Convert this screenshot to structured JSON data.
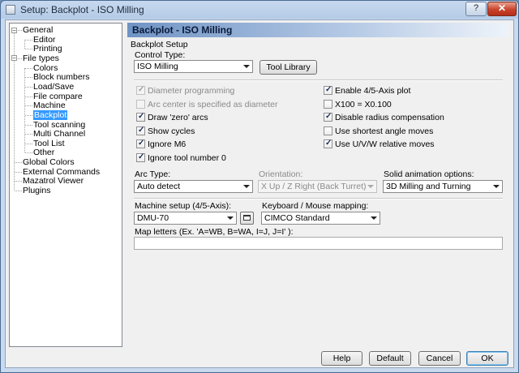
{
  "window": {
    "title": "Setup: Backplot - ISO Milling",
    "help_glyph": "?",
    "close_glyph": "✕",
    "icon": "window-icon"
  },
  "tree": {
    "items": [
      {
        "label": "General",
        "level": 0,
        "expander": "−"
      },
      {
        "label": "Editor",
        "level": 1
      },
      {
        "label": "Printing",
        "level": 1
      },
      {
        "label": "File types",
        "level": 0,
        "expander": "−"
      },
      {
        "label": "Colors",
        "level": 1
      },
      {
        "label": "Block numbers",
        "level": 1
      },
      {
        "label": "Load/Save",
        "level": 1
      },
      {
        "label": "File compare",
        "level": 1
      },
      {
        "label": "Machine",
        "level": 1
      },
      {
        "label": "Backplot",
        "level": 1,
        "selected": true
      },
      {
        "label": "Tool scanning",
        "level": 1
      },
      {
        "label": "Multi Channel",
        "level": 1
      },
      {
        "label": "Tool List",
        "level": 1
      },
      {
        "label": "Other",
        "level": 1
      },
      {
        "label": "Global Colors",
        "level": 0
      },
      {
        "label": "External Commands",
        "level": 0
      },
      {
        "label": "Mazatrol Viewer",
        "level": 0
      },
      {
        "label": "Plugins",
        "level": 0
      }
    ]
  },
  "panel": {
    "header": "Backplot - ISO Milling",
    "group_label": "Backplot Setup",
    "control_type_label": "Control Type:",
    "control_type_value": "ISO Milling",
    "tool_library_button": "Tool Library",
    "checkboxes_left": [
      {
        "label": "Diameter programming",
        "checked": true,
        "disabled": true
      },
      {
        "label": "Arc center is specified as diameter",
        "checked": false,
        "disabled": true
      },
      {
        "label": "Draw 'zero' arcs",
        "checked": true,
        "disabled": false
      },
      {
        "label": "Show cycles",
        "checked": true,
        "disabled": false
      },
      {
        "label": "Ignore M6",
        "checked": true,
        "disabled": false
      },
      {
        "label": "Ignore tool number 0",
        "checked": true,
        "disabled": false
      }
    ],
    "checkboxes_right": [
      {
        "label": "Enable 4/5-Axis plot",
        "checked": true,
        "disabled": false
      },
      {
        "label": "X100 = X0.100",
        "checked": false,
        "disabled": false
      },
      {
        "label": "Disable radius compensation",
        "checked": true,
        "disabled": false
      },
      {
        "label": "Use shortest angle moves",
        "checked": false,
        "disabled": false
      },
      {
        "label": "Use U/V/W relative moves",
        "checked": true,
        "disabled": false
      }
    ],
    "arc_type_label": "Arc Type:",
    "arc_type_value": "Auto detect",
    "orientation_label": "Orientation:",
    "orientation_value": "X Up   / Z Right (Back Turret)",
    "solid_label": "Solid animation options:",
    "solid_value": "3D Milling and Turning",
    "machine_setup_label": "Machine setup (4/5-Axis):",
    "machine_setup_value": "DMU-70",
    "keyboard_label": "Keyboard / Mouse mapping:",
    "keyboard_value": "CIMCO Standard",
    "map_letters_label": "Map letters (Ex. 'A=WB, B=WA, I=J, J=I' ):",
    "map_letters_value": ""
  },
  "footer": {
    "help": "Help",
    "default": "Default",
    "cancel": "Cancel",
    "ok": "OK"
  }
}
